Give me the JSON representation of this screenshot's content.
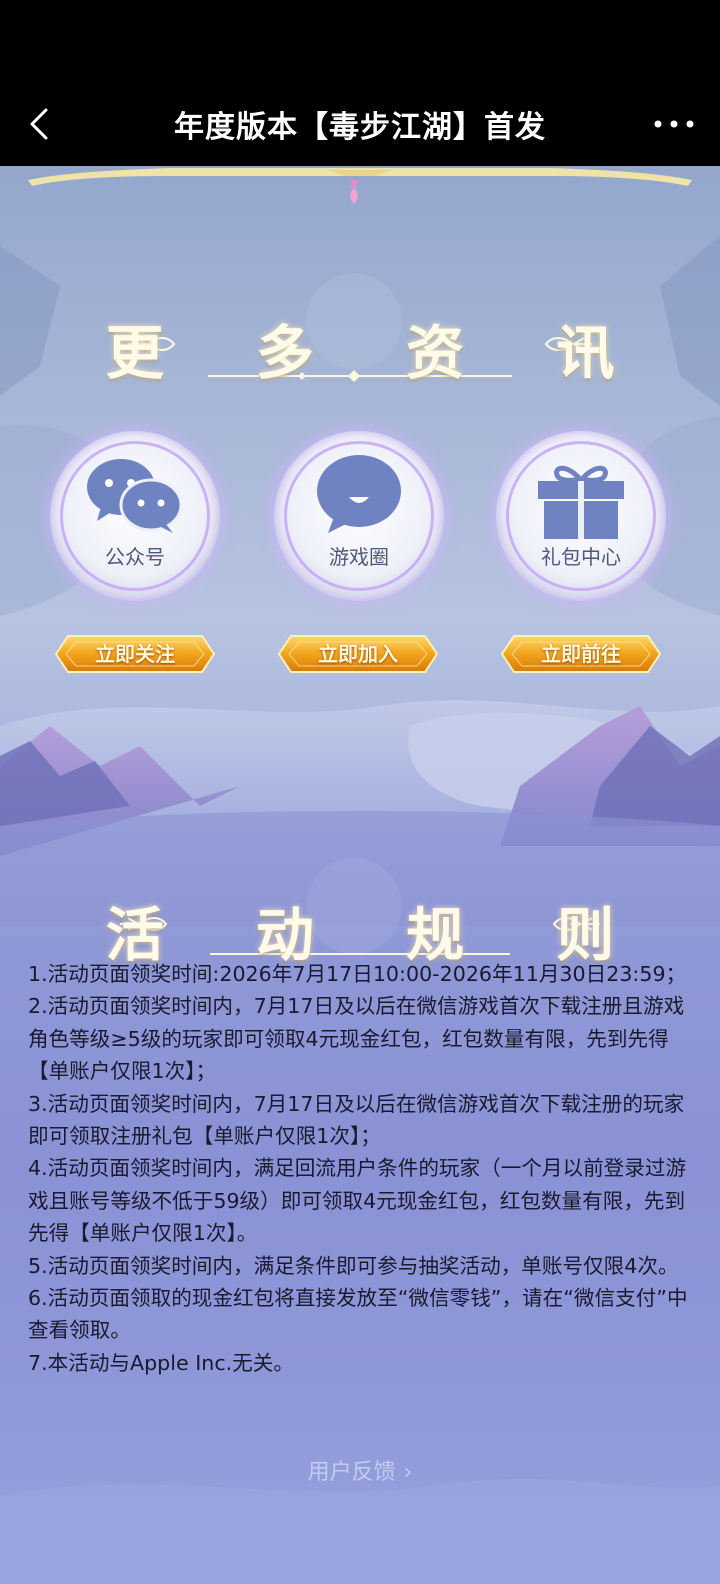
{
  "nav": {
    "title": "年度版本【毒步江湖】首发",
    "back_icon": "chevron-left-icon",
    "more_icon": "more-dots-icon"
  },
  "info_section": {
    "title": "更 多 资 讯",
    "cards": [
      {
        "label": "公众号",
        "icon": "wechat-icon",
        "button": "立即关注"
      },
      {
        "label": "游戏圈",
        "icon": "chat-bubble-icon",
        "button": "立即加入"
      },
      {
        "label": "礼包中心",
        "icon": "gift-icon",
        "button": "立即前往"
      }
    ]
  },
  "rules_section": {
    "title": "活 动 规 则",
    "items": [
      "1.活动页面领奖时间:2026年7月17日10:00-2026年11月30日23:59；",
      "2.活动页面领奖时间内，7月17日及以后在微信游戏首次下载注册且游戏角色等级≥5级的玩家即可领取4元现金红包，红包数量有限，先到先得【单账户仅限1次】；",
      "3.活动页面领奖时间内，7月17日及以后在微信游戏首次下载注册的玩家即可领取注册礼包【单账户仅限1次】；",
      "4.活动页面领奖时间内，满足回流用户条件的玩家（一个月以前登录过游戏且账号等级不低于59级）即可领取4元现金红包，红包数量有限，先到先得【单账户仅限1次】。",
      "5.活动页面领奖时间内，满足条件即可参与抽奖活动，单账号仅限4次。",
      "6.活动页面领取的现金红包将直接发放至“微信零钱”，请在“微信支付”中查看领取。",
      "7.本活动与Apple Inc.无关。"
    ]
  },
  "feedback": {
    "label": "用户反馈"
  },
  "colors": {
    "title_text": "#fffbe8",
    "button_gold": "#f2a41c",
    "rule_text": "#1a1a2e",
    "feedback_text": "#c4cbf2"
  }
}
